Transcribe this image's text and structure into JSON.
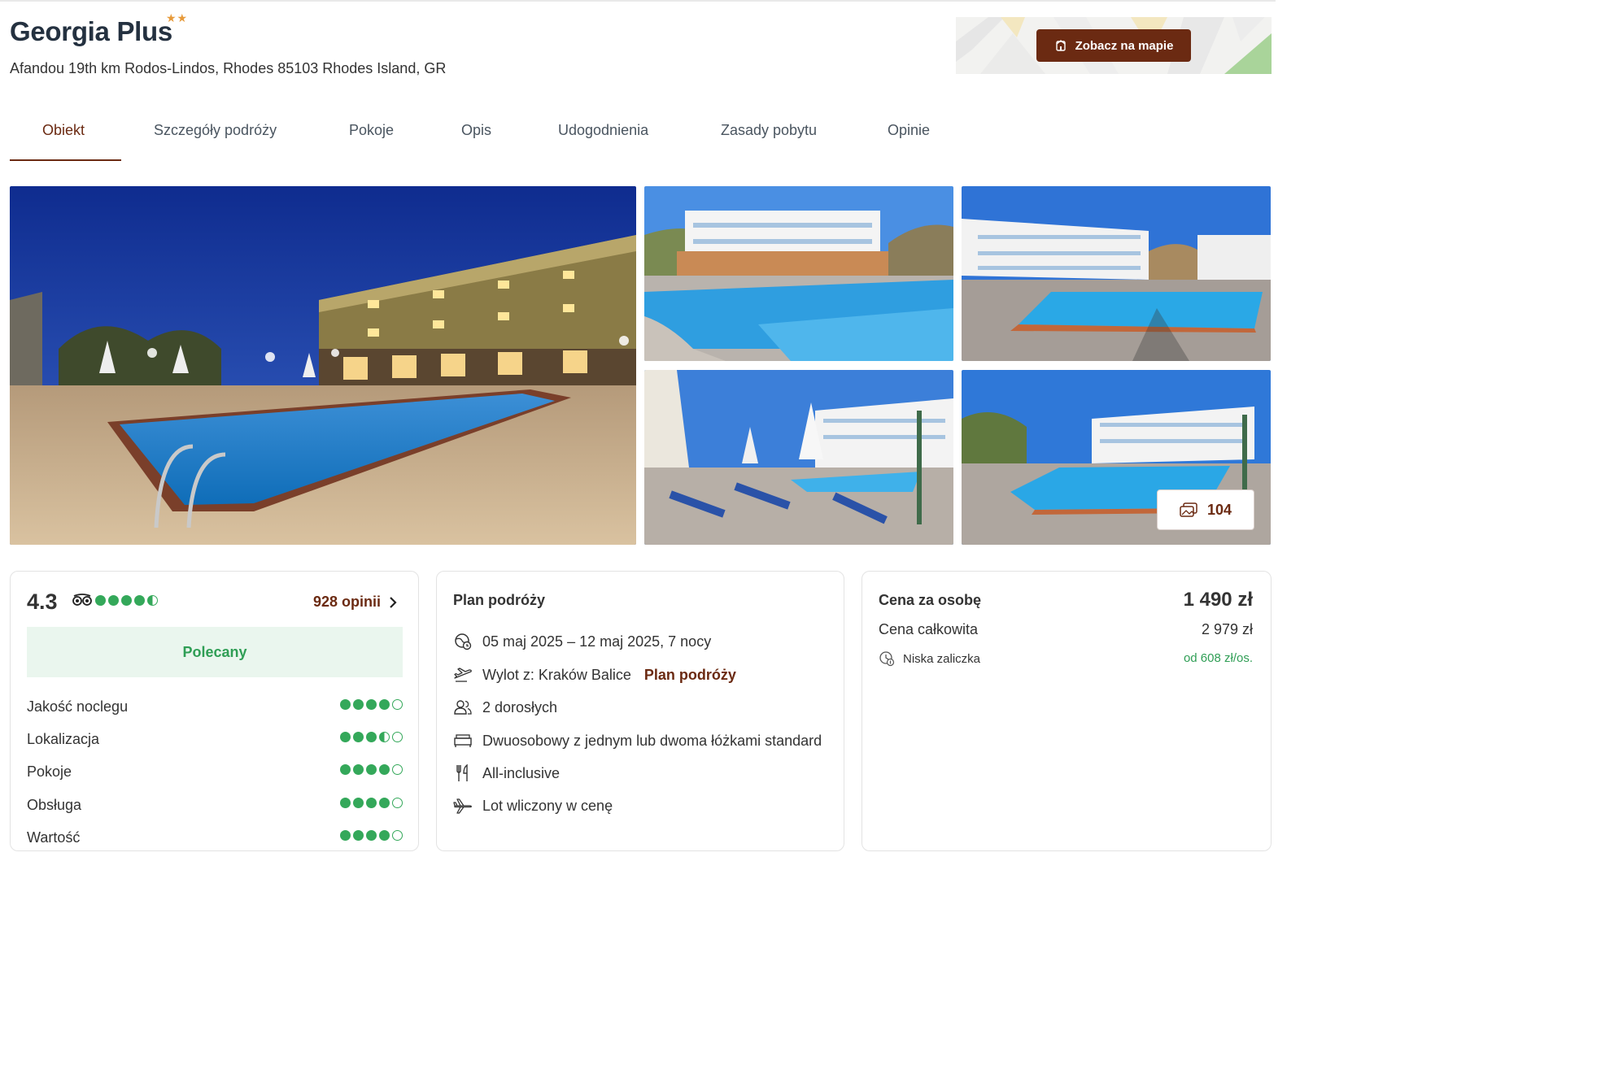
{
  "header": {
    "title": "Georgia Plus",
    "stars": "★★",
    "address": "Afandou 19th km Rodos-Lindos, Rhodes 85103 Rhodes Island, GR",
    "map_button": "Zobacz na mapie"
  },
  "tabs": [
    {
      "label": "Obiekt",
      "active": true
    },
    {
      "label": "Szczegóły podróży"
    },
    {
      "label": "Pokoje"
    },
    {
      "label": "Opis"
    },
    {
      "label": "Udogodnienia"
    },
    {
      "label": "Zasady pobytu"
    },
    {
      "label": "Opinie"
    }
  ],
  "gallery": {
    "photo_count": "104"
  },
  "reviews": {
    "score": "4.3",
    "overall_bubbles": 4.5,
    "count_link": "928 opinii",
    "badge": "Polecany",
    "categories": [
      {
        "label": "Jakość noclegu",
        "rating": 4
      },
      {
        "label": "Lokalizacja",
        "rating": 3.5
      },
      {
        "label": "Pokoje",
        "rating": 4
      },
      {
        "label": "Obsługa",
        "rating": 4
      },
      {
        "label": "Wartość",
        "rating": 4
      }
    ]
  },
  "plan": {
    "title": "Plan podróży",
    "dates": "05 maj 2025 – 12 maj 2025, 7 nocy",
    "departure": "Wylot z: Kraków Balice",
    "departure_link": "Plan podróży",
    "guests": "2 dorosłych",
    "room": "Dwuosobowy z jednym lub dwoma łóżkami standard",
    "board": "All-inclusive",
    "flight": "Lot wliczony w cenę"
  },
  "price": {
    "per_person_label": "Cena za osobę",
    "per_person_value": "1 490 zł",
    "total_label": "Cena całkowita",
    "total_value": "2 979 zł",
    "deposit_label": "Niska zaliczka",
    "deposit_value": "od 608 zł/os."
  },
  "colors": {
    "brand": "#6b2a12",
    "rating_green": "#34a85a",
    "star_orange": "#e79a3a",
    "title_navy": "#243140"
  }
}
